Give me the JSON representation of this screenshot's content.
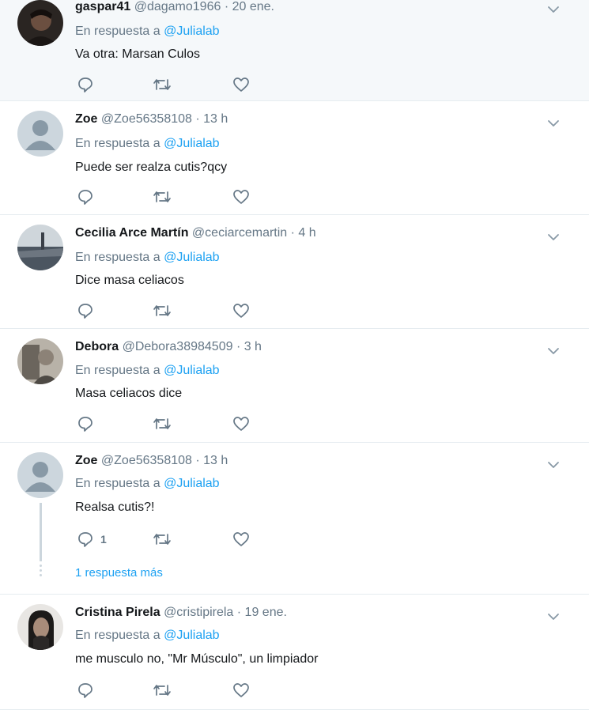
{
  "tweets": [
    {
      "name": "gaspar41",
      "handle": "@dagamo1966",
      "time": "· 20 ene.",
      "reply_prefix": "En respuesta a",
      "reply_to": "@Julialab",
      "text": "Va otra: Marsan Culos",
      "reply_count": ""
    },
    {
      "name": "Zoe",
      "handle": "@Zoe56358108",
      "time": "· 13 h",
      "reply_prefix": "En respuesta a",
      "reply_to": "@Julialab",
      "text": "Puede ser realza cutis?qcy",
      "reply_count": ""
    },
    {
      "name": "Cecilia Arce Martín",
      "handle": "@ceciarcemartin",
      "time": "· 4 h",
      "reply_prefix": "En respuesta a",
      "reply_to": "@Julialab",
      "text": "Dice masa celiacos",
      "reply_count": ""
    },
    {
      "name": "Debora",
      "handle": "@Debora38984509",
      "time": "· 3 h",
      "reply_prefix": "En respuesta a",
      "reply_to": "@Julialab",
      "text": "Masa celiacos dice",
      "reply_count": ""
    },
    {
      "name": "Zoe",
      "handle": "@Zoe56358108",
      "time": "· 13 h",
      "reply_prefix": "En respuesta a",
      "reply_to": "@Julialab",
      "text": "Realsa cutis?!",
      "reply_count": "1",
      "more_replies": "1 respuesta más"
    },
    {
      "name": "Cristina Pirela",
      "handle": "@cristipirela",
      "time": "· 19 ene.",
      "reply_prefix": "En respuesta a",
      "reply_to": "@Julialab",
      "text": "me musculo no, \"Mr Músculo\", un limpiador",
      "reply_count": ""
    }
  ],
  "colors": {
    "link": "#1da1f2",
    "muted": "#657786",
    "divider": "#e6ecf0",
    "highlight": "#f5f8fa"
  },
  "icons": [
    "reply-icon",
    "retweet-icon",
    "like-icon",
    "chevron-down-icon",
    "default-avatar-icon"
  ]
}
